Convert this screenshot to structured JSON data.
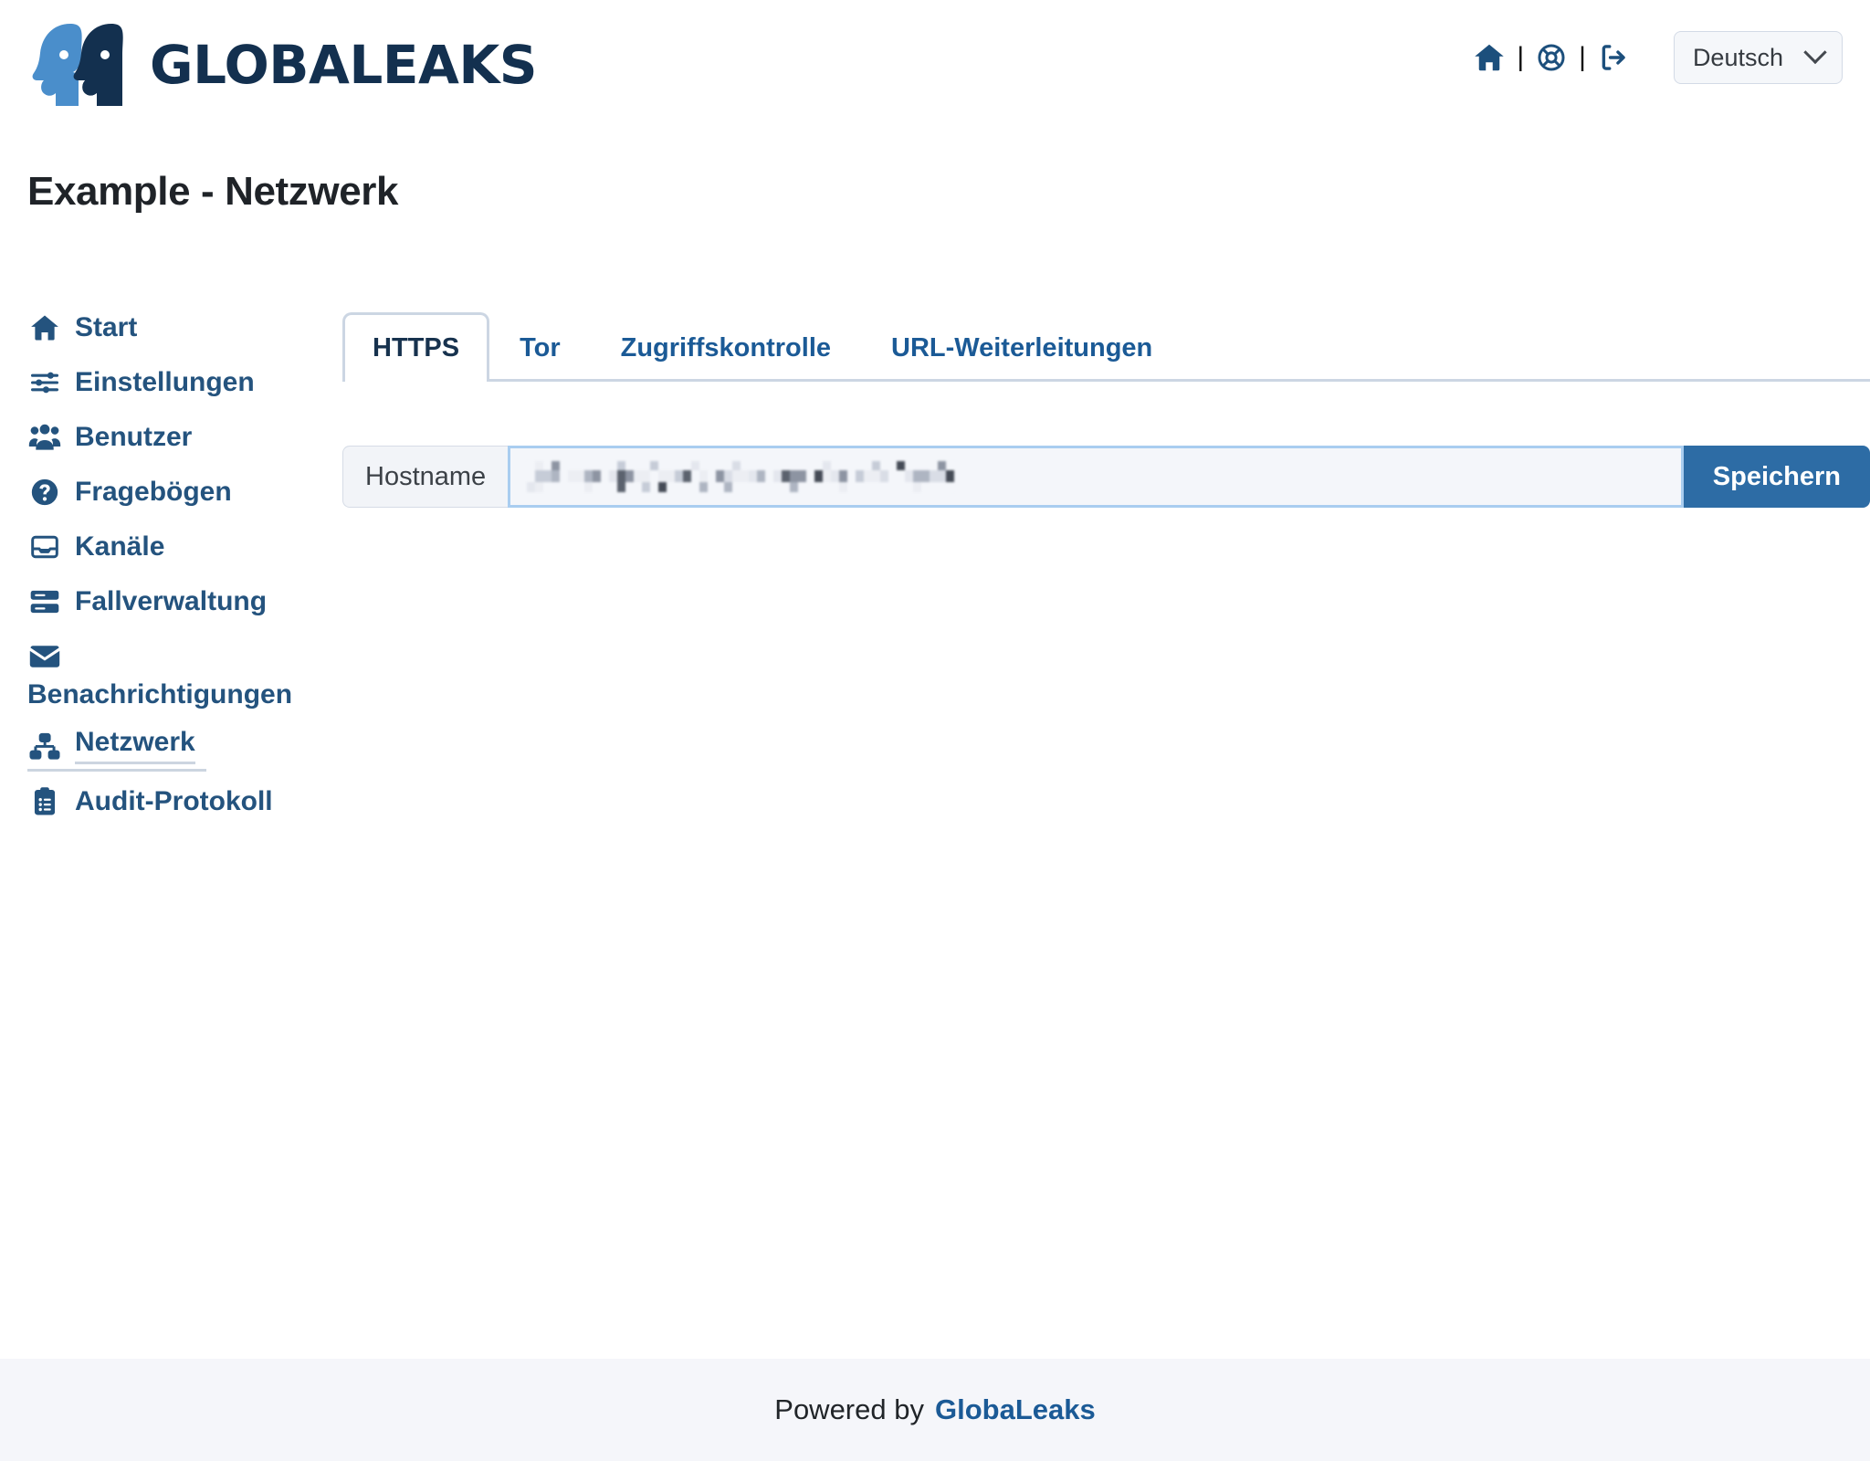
{
  "header": {
    "logo_text": "GLOBALEAKS",
    "logo_icon": "two-faces-logo-icon",
    "icons": [
      {
        "name": "home-icon",
        "title": "Start"
      },
      {
        "name": "life-buoy-support-icon",
        "title": "Support"
      },
      {
        "name": "sign-out-icon",
        "title": "Abmelden"
      }
    ],
    "separator": "|",
    "language": {
      "selected": "Deutsch",
      "chevron": "chevron-down-icon"
    }
  },
  "page": {
    "title": "Example - Netzwerk"
  },
  "sidebar": {
    "items": [
      {
        "label": "Start",
        "icon": "home-icon",
        "active": false,
        "wrap": false
      },
      {
        "label": "Einstellungen",
        "icon": "sliders-icon",
        "active": false,
        "wrap": false
      },
      {
        "label": "Benutzer",
        "icon": "users-icon",
        "active": false,
        "wrap": false
      },
      {
        "label": "Fragebögen",
        "icon": "question-circle-icon",
        "active": false,
        "wrap": false
      },
      {
        "label": "Kanäle",
        "icon": "inbox-icon",
        "active": false,
        "wrap": false
      },
      {
        "label": "Fallverwaltung",
        "icon": "server-icon",
        "active": false,
        "wrap": false
      },
      {
        "label": "Benachrichtigungen",
        "icon": "envelope-icon",
        "active": false,
        "wrap": true
      },
      {
        "label": "Netzwerk",
        "icon": "sitemap-network-icon",
        "active": true,
        "wrap": false
      },
      {
        "label": "Audit-Protokoll",
        "icon": "clipboard-list-icon",
        "active": false,
        "wrap": false
      }
    ]
  },
  "main": {
    "tabs": [
      {
        "label": "HTTPS",
        "active": true
      },
      {
        "label": "Tor",
        "active": false
      },
      {
        "label": "Zugriffskontrolle",
        "active": false
      },
      {
        "label": "URL-Weiterleitungen",
        "active": false
      }
    ],
    "hostname_form": {
      "prefix_label": "Hostname",
      "value": "",
      "value_redacted": true,
      "placeholder": "",
      "save_label": "Speichern"
    }
  },
  "footer": {
    "powered_by": "Powered by",
    "brand_link": "GlobaLeaks"
  },
  "colors": {
    "brand_dark": "#13304f",
    "brand_light": "#4a8ecb",
    "nav_text": "#24537e",
    "tab_link": "#1b5a96",
    "tab_active_text": "#17324e",
    "primary_button": "#2d6ca5",
    "border": "#ccd6e3",
    "input_focus_border": "#a9cdf0",
    "footer_bg": "#f5f6fa",
    "prefix_bg": "#f2f4f8"
  }
}
